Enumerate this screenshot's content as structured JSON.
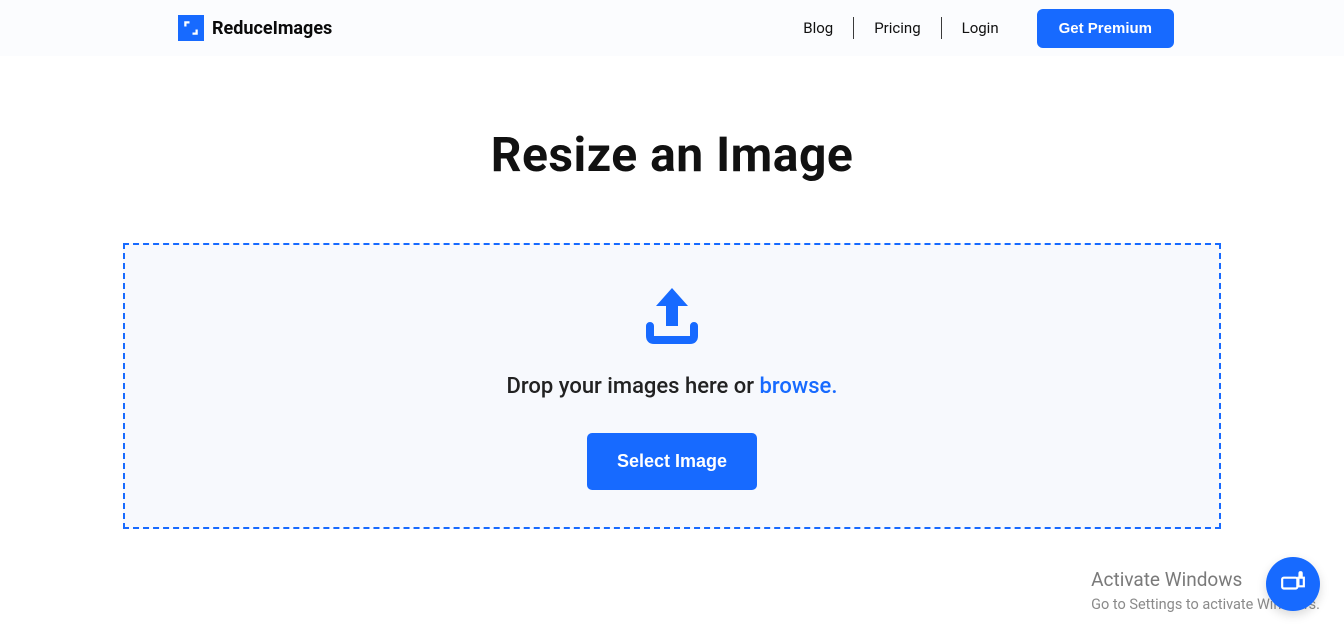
{
  "header": {
    "logo_text": "ReduceImages",
    "nav": {
      "blog": "Blog",
      "pricing": "Pricing",
      "login": "Login",
      "premium": "Get Premium"
    }
  },
  "main": {
    "title": "Resize an Image",
    "drop_text_prefix": "Drop your images here or ",
    "drop_text_browse": "browse.",
    "select_button": "Select Image"
  },
  "watermark": {
    "title": "Activate Windows",
    "subtitle": "Go to Settings to activate Windows."
  },
  "colors": {
    "primary": "#176aff",
    "dropzone_bg": "#f7f9fd"
  }
}
